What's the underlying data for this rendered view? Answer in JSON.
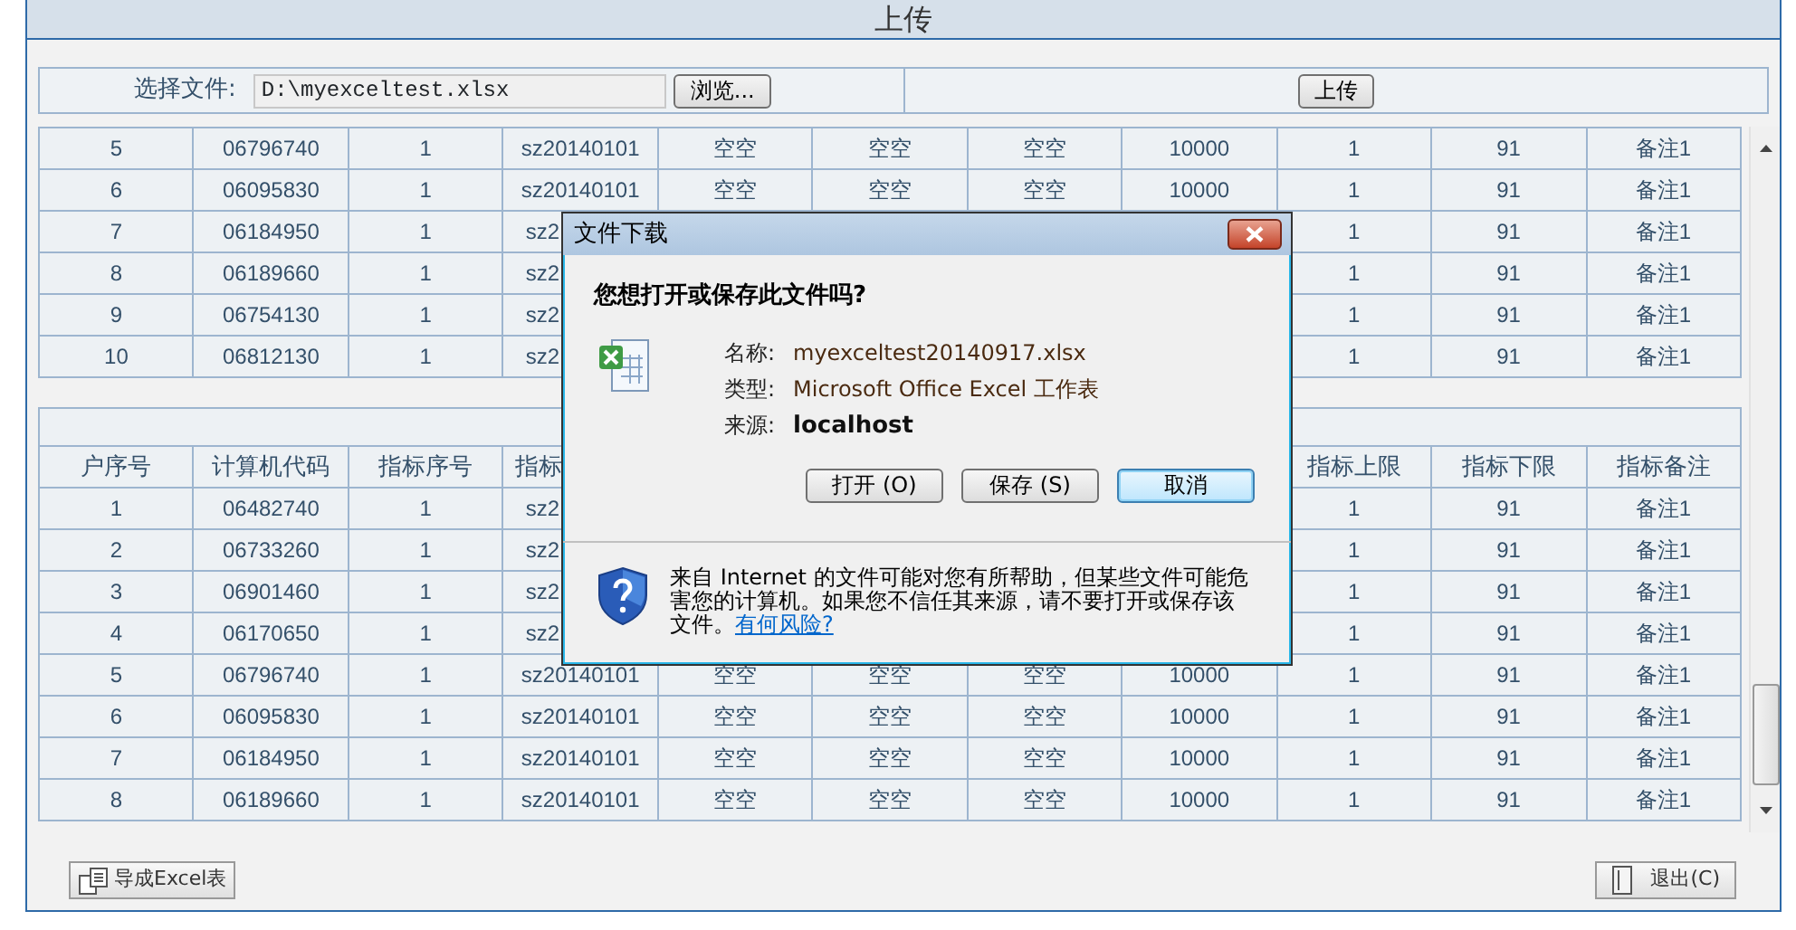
{
  "page_title": "上传",
  "upload": {
    "label": "选择文件:",
    "file_path": "D:\\myexceltest.xlsx",
    "browse_button": "浏览...",
    "upload_button": "上传"
  },
  "table_top": {
    "rows": [
      [
        "5",
        "06796740",
        "1",
        "sz20140101",
        "空空",
        "空空",
        "空空",
        "10000",
        "1",
        "91",
        "备注1"
      ],
      [
        "6",
        "06095830",
        "1",
        "sz20140101",
        "空空",
        "空空",
        "空空",
        "10000",
        "1",
        "91",
        "备注1"
      ],
      [
        "7",
        "06184950",
        "1",
        "sz2",
        null,
        null,
        null,
        null,
        "1",
        "91",
        "备注1"
      ],
      [
        "8",
        "06189660",
        "1",
        "sz2",
        null,
        null,
        null,
        null,
        "1",
        "91",
        "备注1"
      ],
      [
        "9",
        "06754130",
        "1",
        "sz2",
        null,
        null,
        null,
        null,
        "1",
        "91",
        "备注1"
      ],
      [
        "10",
        "06812130",
        "1",
        "sz2",
        null,
        null,
        null,
        null,
        "1",
        "91",
        "备注1"
      ]
    ]
  },
  "table_bottom": {
    "columns": [
      "户序号",
      "计算机代码",
      "指标序号",
      "指标",
      null,
      null,
      null,
      null,
      "指标上限",
      "指标下限",
      "指标备注"
    ],
    "rows": [
      [
        "1",
        "06482740",
        "1",
        "sz2",
        null,
        null,
        null,
        null,
        "1",
        "91",
        "备注1"
      ],
      [
        "2",
        "06733260",
        "1",
        "sz2",
        null,
        null,
        null,
        null,
        "1",
        "91",
        "备注1"
      ],
      [
        "3",
        "06901460",
        "1",
        "sz2",
        null,
        null,
        null,
        null,
        "1",
        "91",
        "备注1"
      ],
      [
        "4",
        "06170650",
        "1",
        "sz2",
        null,
        null,
        null,
        null,
        "1",
        "91",
        "备注1"
      ],
      [
        "5",
        "06796740",
        "1",
        "sz20140101",
        "空空",
        "空空",
        "空空",
        "10000",
        "1",
        "91",
        "备注1"
      ],
      [
        "6",
        "06095830",
        "1",
        "sz20140101",
        "空空",
        "空空",
        "空空",
        "10000",
        "1",
        "91",
        "备注1"
      ],
      [
        "7",
        "06184950",
        "1",
        "sz20140101",
        "空空",
        "空空",
        "空空",
        "10000",
        "1",
        "91",
        "备注1"
      ],
      [
        "8",
        "06189660",
        "1",
        "sz20140101",
        "空空",
        "空空",
        "空空",
        "10000",
        "1",
        "91",
        "备注1"
      ]
    ]
  },
  "dialog": {
    "title": "文件下载",
    "question": "您想打开或保存此文件吗?",
    "fields": [
      {
        "label": "名称:",
        "value": "myexceltest20140917.xlsx",
        "bold": false
      },
      {
        "label": "类型:",
        "value": "Microsoft Office Excel 工作表",
        "bold": false
      },
      {
        "label": "来源:",
        "value": "localhost",
        "bold": true
      }
    ],
    "buttons": [
      {
        "label": "打开 (O)",
        "default": false
      },
      {
        "label": "保存 (S)",
        "default": false
      },
      {
        "label": "取消",
        "default": true
      }
    ],
    "warning": "来自 Internet 的文件可能对您有所帮助，但某些文件可能危害您的计算机。如果您不信任其来源，请不要打开或保存该文件。",
    "warning_link": "有何风险?"
  },
  "footer": {
    "export_button": "导成Excel表",
    "exit_button": "退出(C)"
  }
}
